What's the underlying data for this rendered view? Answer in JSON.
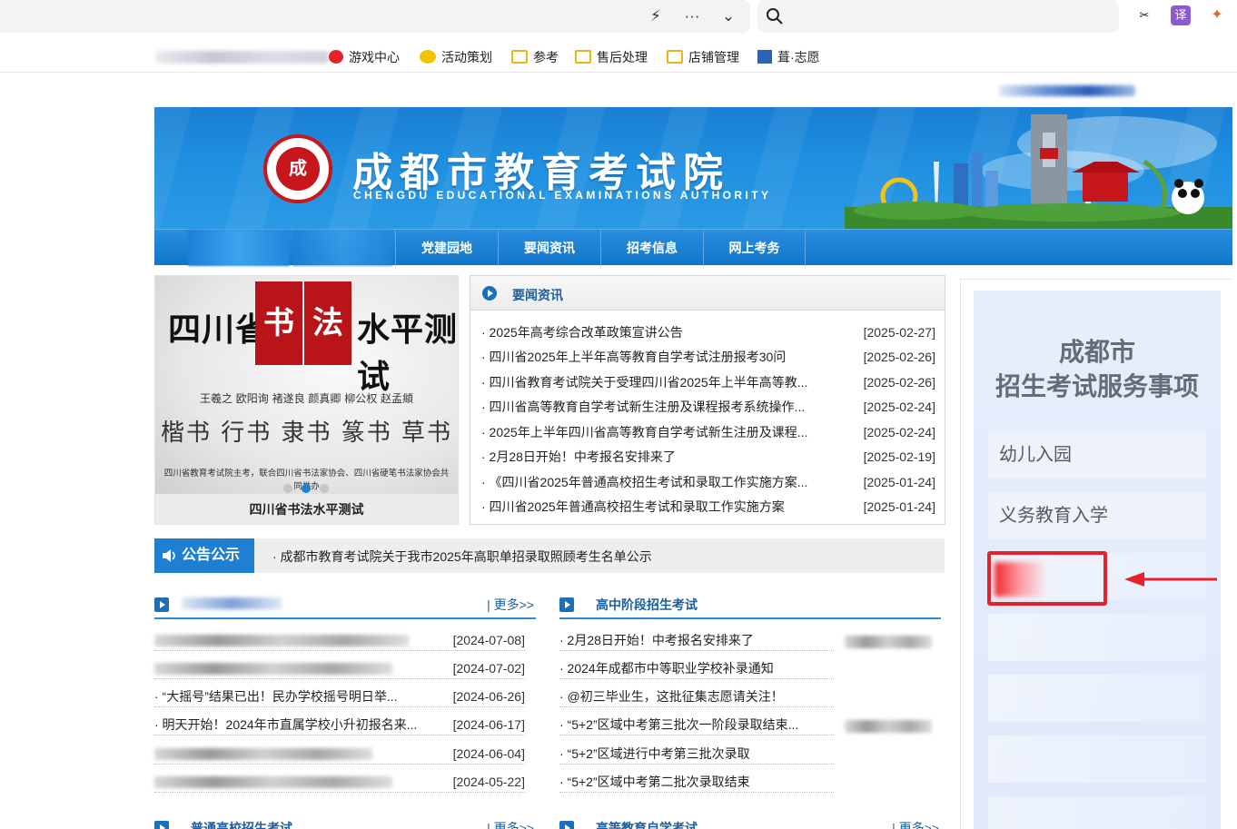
{
  "browser": {
    "bookmarks": [
      {
        "label": "游戏中心"
      },
      {
        "label": "活动策划"
      },
      {
        "label": "参考"
      },
      {
        "label": "售后处理"
      },
      {
        "label": "店铺管理"
      },
      {
        "label": "葺·志愿"
      }
    ]
  },
  "header": {
    "title": "成都市教育考试院",
    "subtitle": "CHENGDU EDUCATIONAL EXAMINATIONS AUTHORITY",
    "seal_text": "成"
  },
  "nav": {
    "items": [
      {
        "label": "党建园地"
      },
      {
        "label": "要闻资讯"
      },
      {
        "label": "招考信息"
      },
      {
        "label": "网上考务"
      }
    ]
  },
  "carousel": {
    "headline_left": "四川省",
    "headline_stamp_1": "书",
    "headline_stamp_2": "法",
    "headline_right": "水平测试",
    "names": "王羲之  欧阳询  褚遂良  颜真卿  柳公权  赵孟頫",
    "scripts": "楷书 行书 隶书 篆书 草书",
    "organizer": "四川省教育考试院主考，联合四川省书法家协会、四川省硬笔书法家协会共同举办",
    "caption": "四川省书法水平测试",
    "slide_count": 3,
    "active_slide": 2
  },
  "news": {
    "title": "要闻资讯",
    "items": [
      {
        "title": "· 2025年高考综合改革政策宣讲公告",
        "date": "[2025-02-27]"
      },
      {
        "title": "· 四川省2025年上半年高等教育自学考试注册报考30问",
        "date": "[2025-02-26]"
      },
      {
        "title": "· 四川省教育考试院关于受理四川省2025年上半年高等教...",
        "date": "[2025-02-26]"
      },
      {
        "title": "· 四川省高等教育自学考试新生注册及课程报考系统操作...",
        "date": "[2025-02-24]"
      },
      {
        "title": "· 2025年上半年四川省高等教育自学考试新生注册及课程...",
        "date": "[2025-02-24]"
      },
      {
        "title": "· 2月28日开始！中考报名安排来了",
        "date": "[2025-02-19]"
      },
      {
        "title": "· 《四川省2025年普通高校招生考试和录取工作实施方案...",
        "date": "[2025-01-24]"
      },
      {
        "title": "· 四川省2025年普通高校招生考试和录取工作实施方案",
        "date": "[2025-01-24]"
      }
    ]
  },
  "notice": {
    "tag": "公告公示",
    "text": "· 成都市教育考试院关于我市2025年高职单招录取照顾考生名单公示"
  },
  "left_list": {
    "more": "| 更多>>",
    "items": [
      {
        "title": "",
        "date": "[2024-07-08]"
      },
      {
        "title": "",
        "date": "[2024-07-02]"
      },
      {
        "title": "· “大摇号”结果已出！民办学校摇号明日举...",
        "date": "[2024-06-26]"
      },
      {
        "title": "· 明天开始！2024年市直属学校小升初报名来...",
        "date": "[2024-06-17]"
      },
      {
        "title": "",
        "date": "[2024-06-04]"
      },
      {
        "title": "",
        "date": "[2024-05-22]"
      }
    ]
  },
  "right_list": {
    "title": "高中阶段招生考试",
    "items": [
      {
        "title": "· 2月28日开始！中考报名安排来了"
      },
      {
        "title": "· 2024年成都市中等职业学校补录通知"
      },
      {
        "title": "· @初三毕业生，这批征集志愿请关注！"
      },
      {
        "title": "· “5+2”区域中考第三批次一阶段录取结束..."
      },
      {
        "title": "· “5+2”区域进行中考第三批次录取"
      },
      {
        "title": "· “5+2”区域中考第二批次录取结束"
      }
    ]
  },
  "bottom_heads": {
    "left_title": "普通高校招生考试",
    "left_more": "| 更多>>",
    "right_title": "高等教育自学考试",
    "right_more": "| 更多>>"
  },
  "sidebar": {
    "title_line1": "成都市",
    "title_line2": "招生考试服务事项",
    "buttons": [
      {
        "label": "幼儿入园"
      },
      {
        "label": "义务教育入学"
      }
    ]
  },
  "colors": {
    "brand_blue": "#1f7fd0",
    "heading_blue": "#1d5f9e",
    "seal_red": "#c8161d",
    "highlight_red": "#e5222b"
  }
}
